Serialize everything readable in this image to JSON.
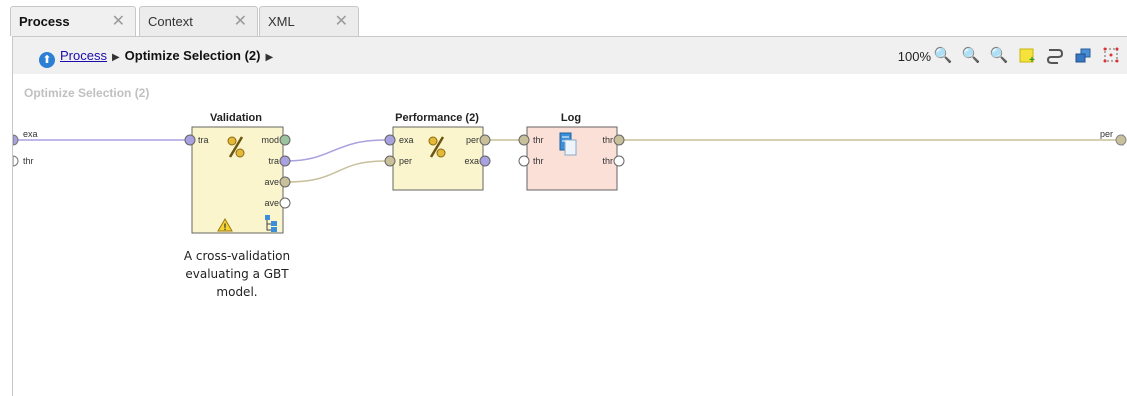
{
  "tabs": [
    {
      "label": "Process"
    },
    {
      "label": "Context"
    },
    {
      "label": "XML"
    }
  ],
  "breadcrumb": {
    "root": "Process",
    "current": "Optimize Selection (2)"
  },
  "toolbar": {
    "zoom": "100%",
    "icons": [
      "zoom-reset-icon",
      "zoom-in-icon",
      "zoom-out-icon",
      "add-note-icon",
      "auto-wire-icon",
      "arrange-icon",
      "fit-icon"
    ]
  },
  "process": {
    "title": "Optimize Selection (2)",
    "inputs": [
      "exa",
      "thr"
    ],
    "output": "per"
  },
  "operators": {
    "validation": {
      "name": "Validation",
      "in": [
        "tra"
      ],
      "out": [
        "mod",
        "tra",
        "ave",
        "ave"
      ],
      "note": "A cross-validation evaluating a GBT model."
    },
    "performance": {
      "name": "Performance (2)",
      "in": [
        "exa",
        "per"
      ],
      "out": [
        "per",
        "exa"
      ]
    },
    "log": {
      "name": "Log",
      "in": [
        "thr",
        "thr"
      ],
      "out": [
        "thr",
        "thr"
      ]
    }
  },
  "colors": {
    "operator_fill": "#faf5cc",
    "log_fill": "#fbe0d8",
    "exampleset_port": "#a9a2e0",
    "performance_port": "#c8c09a",
    "model_port": "#9cc3a0"
  }
}
